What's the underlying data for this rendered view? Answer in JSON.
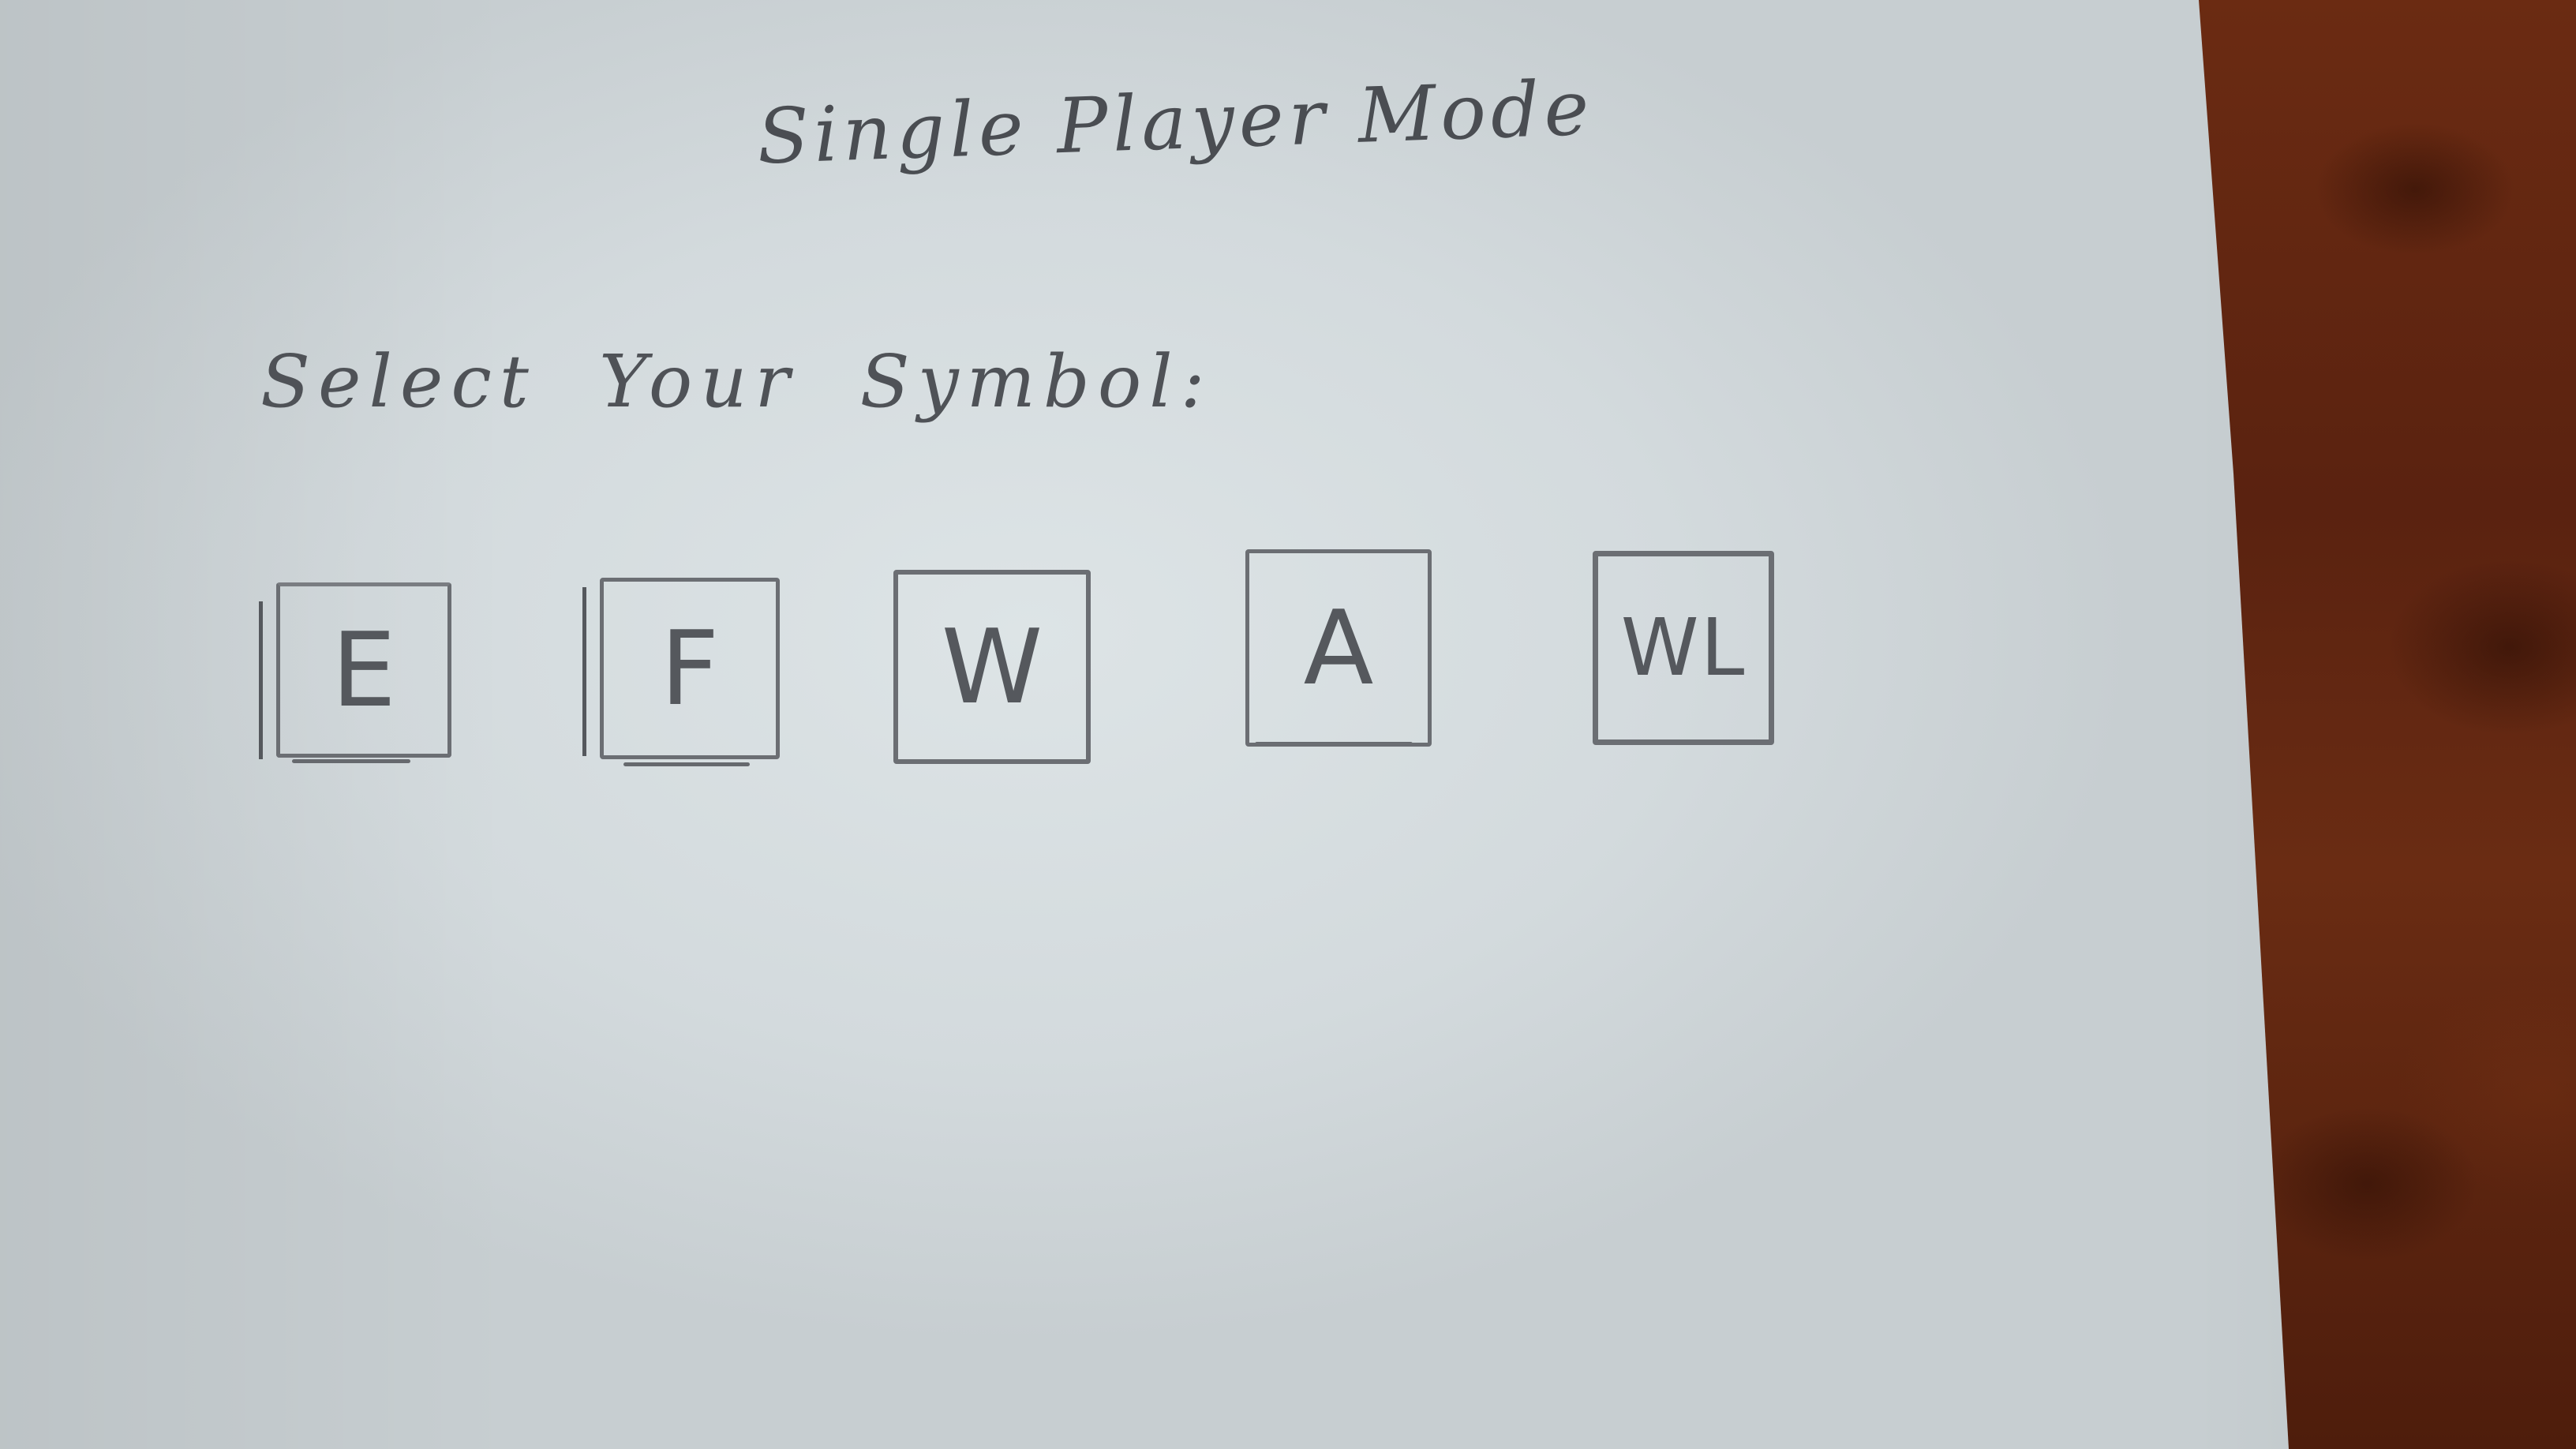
{
  "screen": {
    "title": "Single Player Mode",
    "prompt": "Select Your Symbol:"
  },
  "symbols": [
    {
      "label": "E"
    },
    {
      "label": "F"
    },
    {
      "label": "W"
    },
    {
      "label": "A"
    },
    {
      "label": "WL"
    }
  ]
}
